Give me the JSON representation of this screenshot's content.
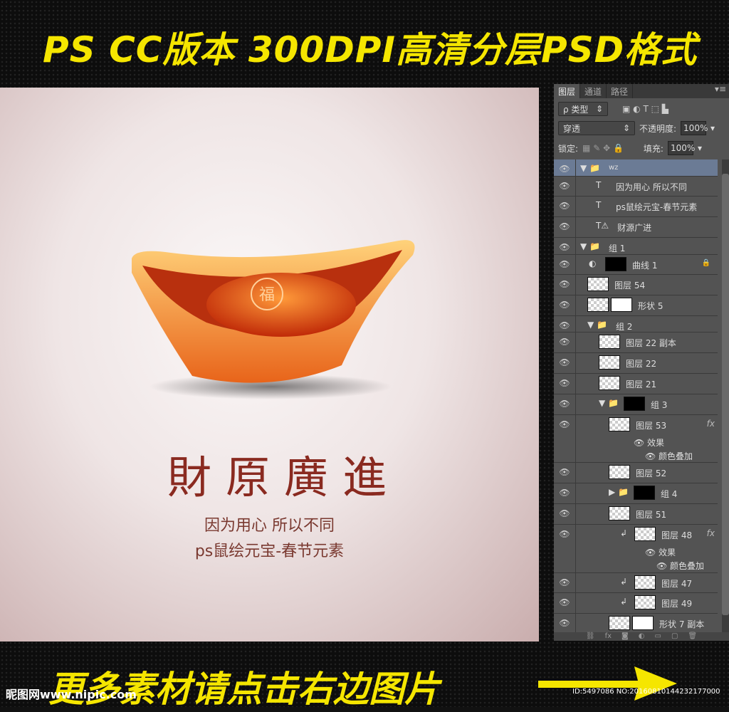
{
  "banner_top": "PS CC版本    300DPI高清分层PSD格式",
  "banner_bottom": "更多素材请点击右边图片",
  "watermark": "昵图网www.nipic.com",
  "image_id": "ID:5497086 NO:20160810144232177000",
  "canvas": {
    "title_calligraphy": "財原廣進",
    "line1": "因为用心  所以不同",
    "line2": "ps鼠绘元宝-春节元素",
    "seal_char": "福"
  },
  "panel": {
    "tabs": [
      "图层",
      "通道",
      "路径"
    ],
    "filter": "ρ 类型",
    "blend": "穿透",
    "opacity_label": "不透明度:",
    "opacity": "100%",
    "lock_label": "锁定:",
    "fill_label": "填充:",
    "fill": "100%",
    "layers": [
      {
        "label": "wz",
        "kind": "folder",
        "selected": true
      },
      {
        "label": "因为用心  所以不同",
        "kind": "text"
      },
      {
        "label": "ps鼠绘元宝-春节元素",
        "kind": "text"
      },
      {
        "label": "财源广进",
        "kind": "text-warning"
      },
      {
        "label": "组 1",
        "kind": "folder"
      },
      {
        "label": "曲线 1",
        "kind": "adjustment",
        "locked": true
      },
      {
        "label": "图层 54",
        "kind": "layer"
      },
      {
        "label": "形状 5",
        "kind": "shape"
      },
      {
        "label": "组 2",
        "kind": "folder"
      },
      {
        "label": "图层 22 副本",
        "kind": "layer"
      },
      {
        "label": "图层 22",
        "kind": "layer"
      },
      {
        "label": "图层 21",
        "kind": "layer"
      },
      {
        "label": "组 3",
        "kind": "folder-mask"
      },
      {
        "label": "图层 53",
        "kind": "layer",
        "fx": true,
        "effects": [
          "效果",
          "颜色叠加"
        ]
      },
      {
        "label": "图层 52",
        "kind": "layer"
      },
      {
        "label": "组 4",
        "kind": "folder-mask",
        "collapsed": true
      },
      {
        "label": "图层 51",
        "kind": "layer"
      },
      {
        "label": "图层 48",
        "kind": "layer",
        "clip": true,
        "fx": true,
        "effects": [
          "效果",
          "颜色叠加"
        ]
      },
      {
        "label": "图层 47",
        "kind": "layer",
        "clip": true
      },
      {
        "label": "图层 49",
        "kind": "layer",
        "clip": true
      },
      {
        "label": "形状 7 副本",
        "kind": "shape"
      }
    ]
  },
  "colors": {
    "banner": "#f5e600",
    "selected_row": "#6b7b95",
    "panel": "#535353"
  }
}
